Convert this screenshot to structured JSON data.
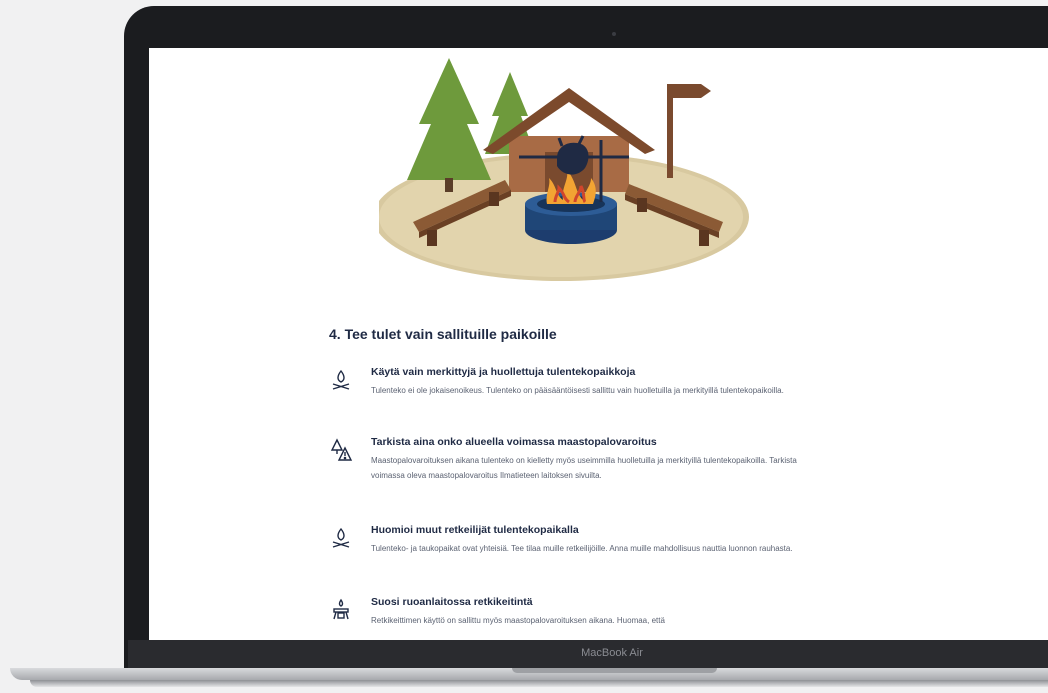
{
  "device": {
    "model_label": "MacBook Air"
  },
  "page": {
    "section_title": "4. Tee tulet vain sallituille paikoille",
    "items": [
      {
        "icon": "campfire-icon",
        "heading": "Käytä vain merkittyjä ja huollettuja tulentekopaikkoja",
        "text": "Tulenteko ei ole jokaisenoikeus. Tulenteko on pääsääntöisesti sallittu vain huolletuilla ja merkityillä tulentekopaikoilla."
      },
      {
        "icon": "forest-fire-warning-icon",
        "heading": "Tarkista aina onko alueella voimassa maastopalovaroitus",
        "text": "Maastopalovaroituksen aikana tulenteko on kielletty myös useimmilla huolletuilla ja merkityillä tulentekopaikoilla. Tarkista voimassa oleva maastopalovaroitus Ilmatieteen laitoksen sivuilta."
      },
      {
        "icon": "campfire-icon",
        "heading": "Huomioi muut retkeilijät tulentekopaikalla",
        "text": "Tulenteko- ja taukopaikat ovat yhteisiä. Tee tilaa muille retkeilijöille. Anna muille mahdollisuus nauttia luonnon rauhasta."
      },
      {
        "icon": "camping-stove-icon",
        "heading": "Suosi ruoanlaitossa retkikeitintä",
        "text": "Retkikeittimen käyttö on sallittu myös maastopalovaroituksen aikana. Huomaa, että"
      }
    ]
  }
}
